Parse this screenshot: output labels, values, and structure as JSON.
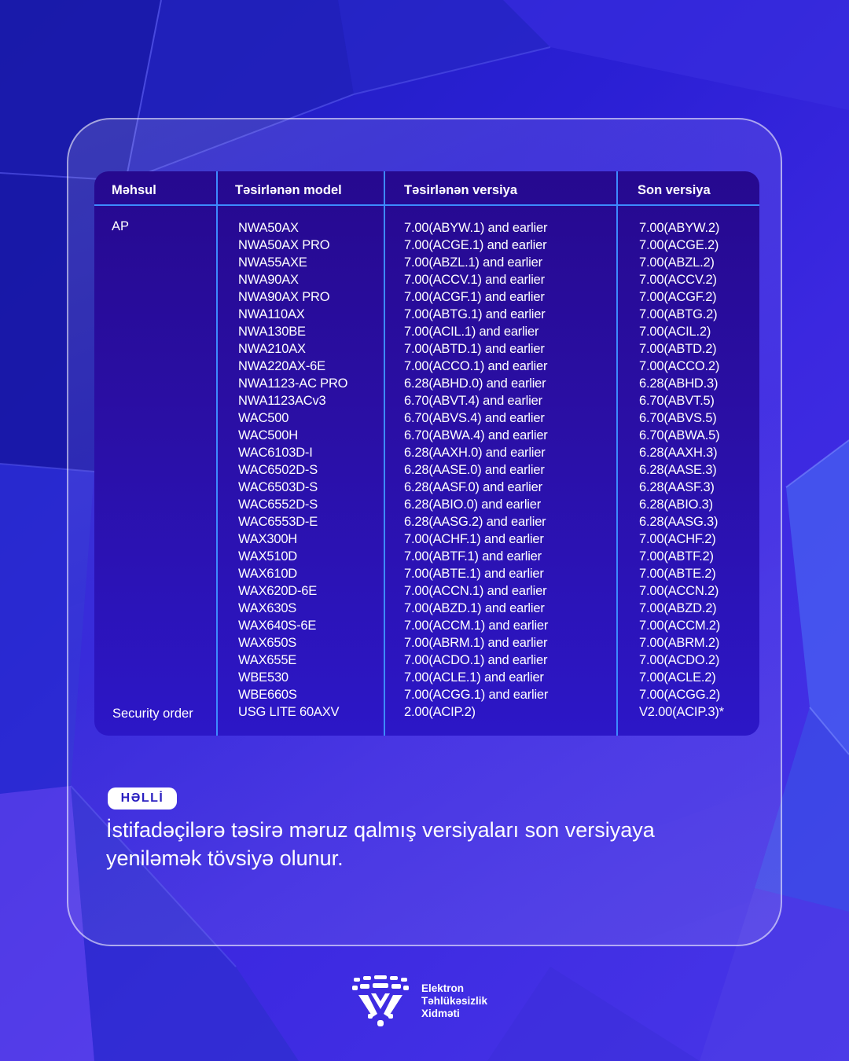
{
  "table": {
    "headers": [
      "Məhsul",
      "Təsirlənən model",
      "Təsirlənən versiya",
      "Son versiya"
    ],
    "categories": [
      {
        "label": "AP"
      },
      {
        "label": "Security order"
      }
    ],
    "rows": [
      {
        "model": "NWA50AX",
        "affected": "7.00(ABYW.1) and earlier",
        "latest": "7.00(ABYW.2)"
      },
      {
        "model": "NWA50AX PRO",
        "affected": "7.00(ACGE.1) and earlier",
        "latest": "7.00(ACGE.2)"
      },
      {
        "model": "NWA55AXE",
        "affected": "7.00(ABZL.1) and earlier",
        "latest": "7.00(ABZL.2)"
      },
      {
        "model": "NWA90AX",
        "affected": "7.00(ACCV.1) and earlier",
        "latest": "7.00(ACCV.2)"
      },
      {
        "model": "NWA90AX PRO",
        "affected": "7.00(ACGF.1) and earlier",
        "latest": "7.00(ACGF.2)"
      },
      {
        "model": "NWA110AX",
        "affected": "7.00(ABTG.1) and earlier",
        "latest": "7.00(ABTG.2)"
      },
      {
        "model": "NWA130BE",
        "affected": "7.00(ACIL.1) and earlier",
        "latest": "7.00(ACIL.2)"
      },
      {
        "model": "NWA210AX",
        "affected": "7.00(ABTD.1) and earlier",
        "latest": "7.00(ABTD.2)"
      },
      {
        "model": "NWA220AX-6E",
        "affected": "7.00(ACCO.1) and earlier",
        "latest": "7.00(ACCO.2)"
      },
      {
        "model": "NWA1123-AC PRO",
        "affected": "6.28(ABHD.0) and earlier",
        "latest": "6.28(ABHD.3)"
      },
      {
        "model": "NWA1123ACv3",
        "affected": "6.70(ABVT.4) and earlier",
        "latest": "6.70(ABVT.5)"
      },
      {
        "model": "WAC500",
        "affected": "6.70(ABVS.4) and earlier",
        "latest": "6.70(ABVS.5)"
      },
      {
        "model": "WAC500H",
        "affected": "6.70(ABWA.4) and earlier",
        "latest": "6.70(ABWA.5)"
      },
      {
        "model": "WAC6103D-I",
        "affected": "6.28(AAXH.0) and earlier",
        "latest": "6.28(AAXH.3)"
      },
      {
        "model": "WAC6502D-S",
        "affected": "6.28(AASE.0) and earlier",
        "latest": "6.28(AASE.3)"
      },
      {
        "model": "WAC6503D-S",
        "affected": "6.28(AASF.0) and earlier",
        "latest": "6.28(AASF.3)"
      },
      {
        "model": "WAC6552D-S",
        "affected": "6.28(ABIO.0) and earlier",
        "latest": "6.28(ABIO.3)"
      },
      {
        "model": "WAC6553D-E",
        "affected": "6.28(AASG.2) and earlier",
        "latest": "6.28(AASG.3)"
      },
      {
        "model": "WAX300H",
        "affected": "7.00(ACHF.1) and earlier",
        "latest": "7.00(ACHF.2)"
      },
      {
        "model": "WAX510D",
        "affected": "7.00(ABTF.1) and earlier",
        "latest": "7.00(ABTF.2)"
      },
      {
        "model": "WAX610D",
        "affected": "7.00(ABTE.1) and earlier",
        "latest": "7.00(ABTE.2)"
      },
      {
        "model": "WAX620D-6E",
        "affected": "7.00(ACCN.1) and earlier",
        "latest": "7.00(ACCN.2)"
      },
      {
        "model": "WAX630S",
        "affected": "7.00(ABZD.1) and earlier",
        "latest": "7.00(ABZD.2)"
      },
      {
        "model": "WAX640S-6E",
        "affected": "7.00(ACCM.1) and earlier",
        "latest": "7.00(ACCM.2)"
      },
      {
        "model": "WAX650S",
        "affected": "7.00(ABRM.1) and earlier",
        "latest": "7.00(ABRM.2)"
      },
      {
        "model": "WAX655E",
        "affected": "7.00(ACDO.1) and earlier",
        "latest": "7.00(ACDO.2)"
      },
      {
        "model": "WBE530",
        "affected": "7.00(ACLE.1) and earlier",
        "latest": "7.00(ACLE.2)"
      },
      {
        "model": "WBE660S",
        "affected": "7.00(ACGG.1) and earlier",
        "latest": "7.00(ACGG.2)"
      },
      {
        "model": "USG LITE 60AXV",
        "affected": "2.00(ACIP.2)",
        "latest": "V2.00(ACIP.3)*"
      }
    ]
  },
  "solution": {
    "badge": "HƏLLİ",
    "text": "İstifadəçilərə təsirə məruz qalmış versiyaları son versiyaya yeniləmək tövsiyə olunur."
  },
  "footer": {
    "org_line1": "Elektron",
    "org_line2": "Təhlükəsizlik",
    "org_line3": "Xidməti",
    "logo_icon": "shield-dots-logo-icon"
  },
  "colors": {
    "background": "#2a1fd4",
    "table_bg": "#26098f",
    "grid_line": "#3d8bff",
    "badge_text": "#2a1fc0"
  }
}
